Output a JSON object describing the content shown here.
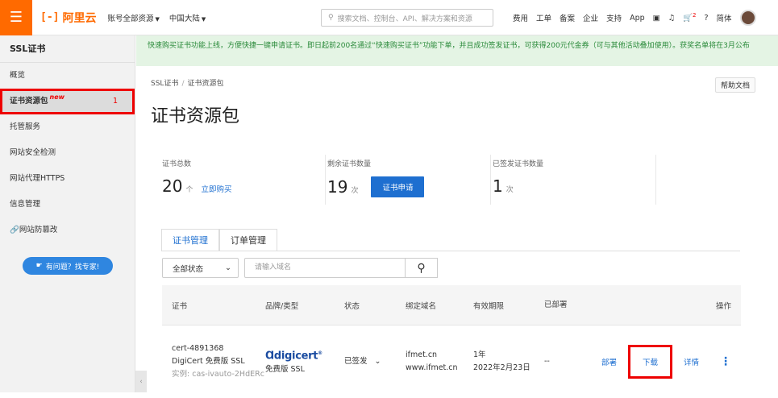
{
  "topbar": {
    "logo_mark": "[-]",
    "logo_text": "阿里云",
    "account_scope": "账号全部资源",
    "region": "中国大陆",
    "search_placeholder": "搜索文档、控制台、API、解决方案和资源",
    "links": [
      "费用",
      "工单",
      "备案",
      "企业",
      "支持",
      "App"
    ],
    "cart_badge": "2",
    "lang": "简体"
  },
  "sidebar": {
    "title": "SSL证书",
    "items": [
      {
        "label": "概览"
      },
      {
        "label": "证书资源包",
        "tag": "new",
        "count": "1",
        "active": true
      },
      {
        "label": "托管服务"
      },
      {
        "label": "网站安全检测"
      },
      {
        "label": "网站代理HTTPS"
      },
      {
        "label": "信息管理"
      },
      {
        "label": "网站防篡改"
      }
    ],
    "help_button": "有问题？找专家!"
  },
  "main": {
    "notice": "快速购买证书功能上线，方便快捷一键申请证书。即日起前200名通过“快速购买证书”功能下单，并且成功签发证书，可获得200元代金券（可与其他活动叠加使用）。获奖名单将在3月公布",
    "breadcrumb": [
      "SSL证书",
      "证书资源包"
    ],
    "help_doc": "帮助文档",
    "title": "证书资源包",
    "stats": [
      {
        "label": "证书总数",
        "value": "20",
        "unit": "个",
        "link": "立即购买"
      },
      {
        "label": "剩余证书数量",
        "value": "19",
        "unit": "次",
        "button": "证书申请"
      },
      {
        "label": "已签发证书数量",
        "value": "1",
        "unit": "次"
      }
    ],
    "tabs": [
      "证书管理",
      "订单管理"
    ],
    "filter_value": "全部状态",
    "domain_placeholder": "请输入域名",
    "table": {
      "headers": [
        "证书",
        "品牌/类型",
        "状态",
        "绑定域名",
        "有效期限",
        "已部署",
        "操作"
      ],
      "row": {
        "cert_id": "cert-4891368",
        "cert_name": "DigiCert 免费版 SSL",
        "instance": "实例: cas-ivauto-2HdERc",
        "brand": "digicert",
        "type": "免费版 SSL",
        "status": "已签发",
        "domains": [
          "ifmet.cn",
          "www.ifmet.cn"
        ],
        "validity": [
          "1年",
          "2022年2月23日"
        ],
        "deployed": "--",
        "actions": [
          "部署",
          "下载",
          "详情"
        ]
      }
    }
  }
}
